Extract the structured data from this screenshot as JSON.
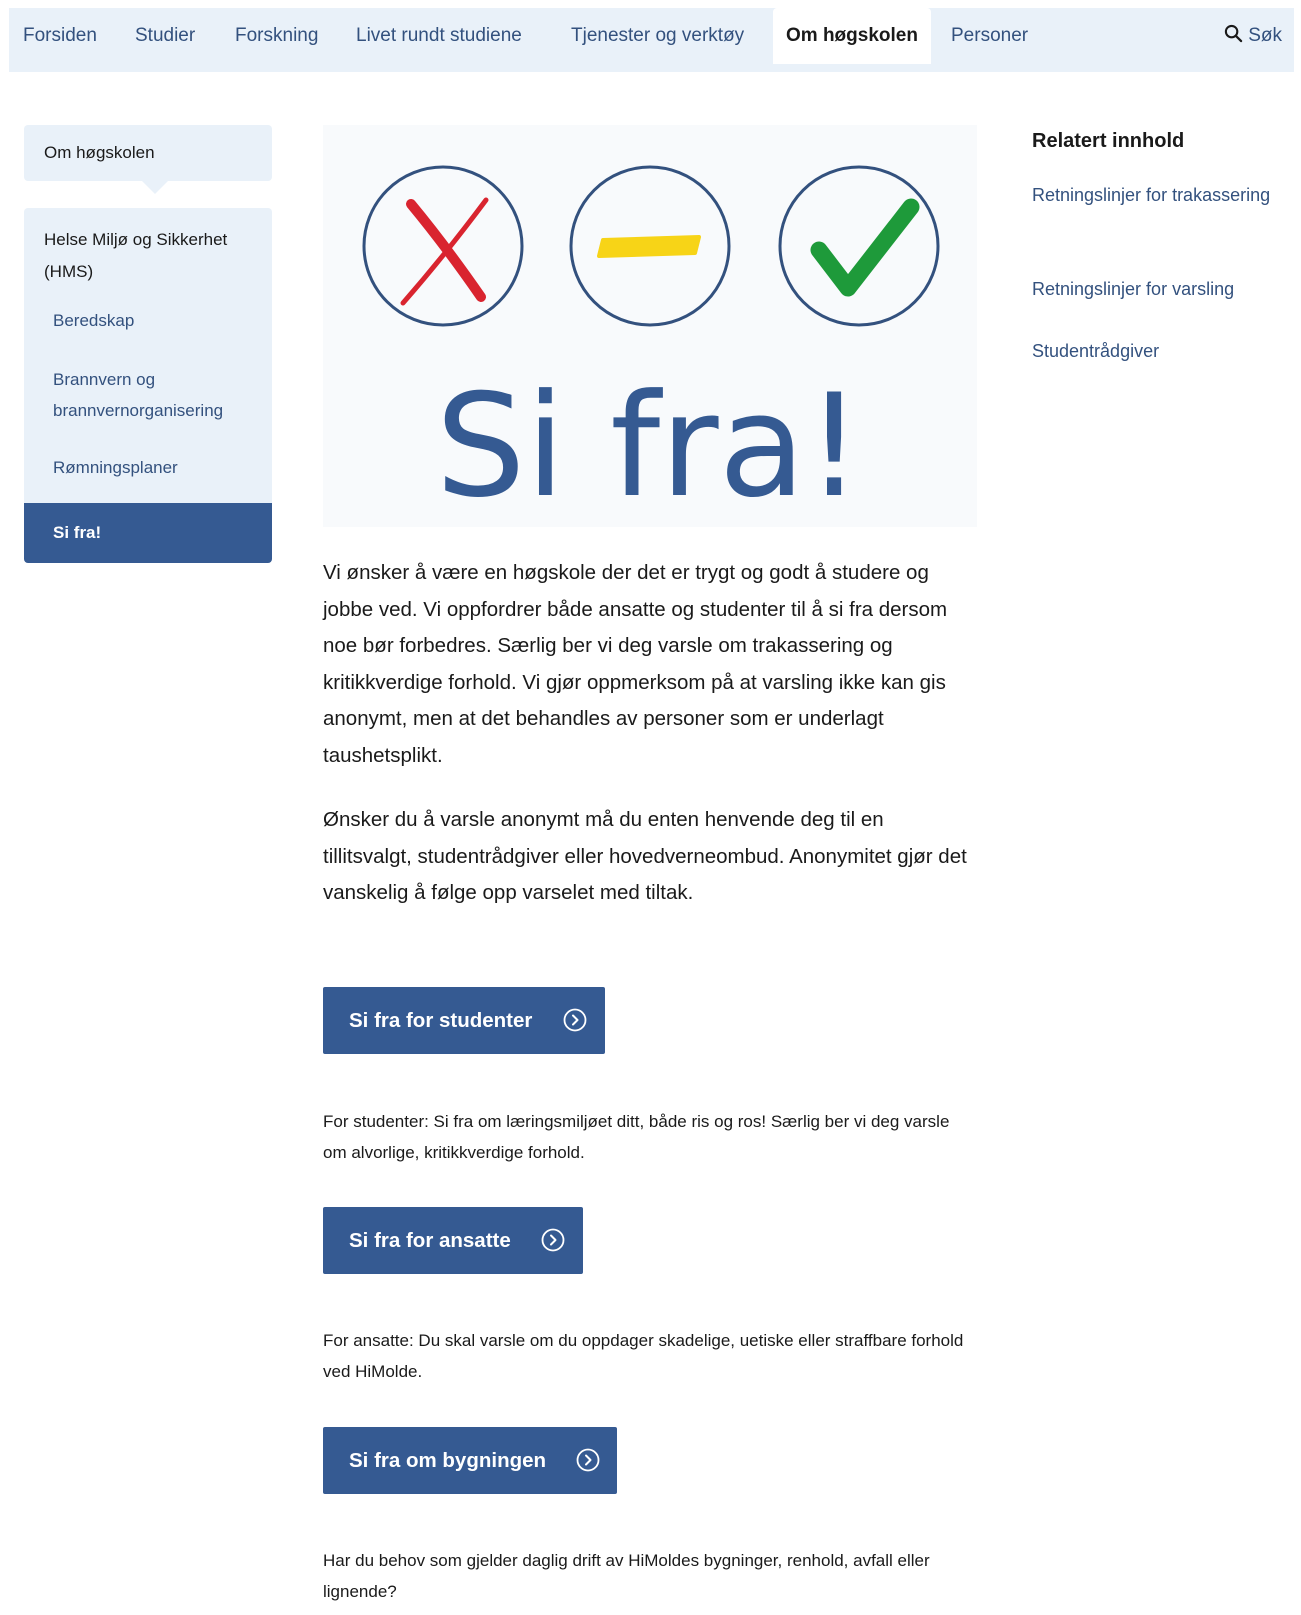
{
  "nav": {
    "items": [
      "Forsiden",
      "Studier",
      "Forskning",
      "Livet rundt studiene",
      "Tjenester og verktøy",
      "Om høgskolen",
      "Personer"
    ],
    "active": "Om høgskolen",
    "search_label": "Søk"
  },
  "sidebar": {
    "parent": "Om høgskolen",
    "section": "Helse Miljø og Sikkerhet (HMS)",
    "items": [
      "Beredskap",
      "Brannvern og brannvernorganisering",
      "Rømningsplaner",
      "Si fra!"
    ],
    "active": "Si fra!"
  },
  "hero": {
    "heading": "Si fra!",
    "icons": [
      "cross-icon",
      "dash-icon",
      "check-icon"
    ],
    "colors": {
      "circle": "#33517e",
      "cross": "#d9242f",
      "dash": "#f7d417",
      "check": "#1e9a3a",
      "text": "#355a92"
    }
  },
  "main": {
    "intro": "Vi ønsker å være en høgskole der det er trygt og godt å studere og jobbe ved. Vi oppfordrer både ansatte og studenter til å si fra dersom noe bør forbedres. Særlig ber vi deg varsle om trakassering og kritikkverdige forhold. Vi gjør oppmerksom på at varsling ikke kan gis anonymt, men at det behandles av personer som er underlagt taushetsplikt.",
    "anonymous": "Ønsker du å varsle anonymt må du enten henvende deg til en tillitsvalgt, studentrådgiver eller hovedverneombud. Anonymitet gjør det vanskelig å følge opp varselet med tiltak.",
    "buttons": [
      {
        "label": "Si fra for studenter",
        "text": "For studenter: Si fra om læringsmiljøet ditt, både ris og ros! Særlig ber vi deg varsle om alvorlige, kritikkverdige forhold."
      },
      {
        "label": "Si fra for ansatte",
        "text": "For ansatte: Du skal varsle om du oppdager skadelige, uetiske eller straffbare forhold ved HiMolde."
      },
      {
        "label": "Si fra om bygningen",
        "text": "Har du behov som gjelder daglig drift av HiMoldes bygninger, renhold, avfall eller lignende?"
      }
    ]
  },
  "related": {
    "title": "Relatert innhold",
    "links": [
      "Retningslinjer for trakassering",
      "Retningslinjer for varsling",
      "Studentrådgiver"
    ]
  },
  "colors": {
    "nav_bg": "#e9f1f9",
    "primary": "#355a92",
    "link": "#33517e"
  }
}
